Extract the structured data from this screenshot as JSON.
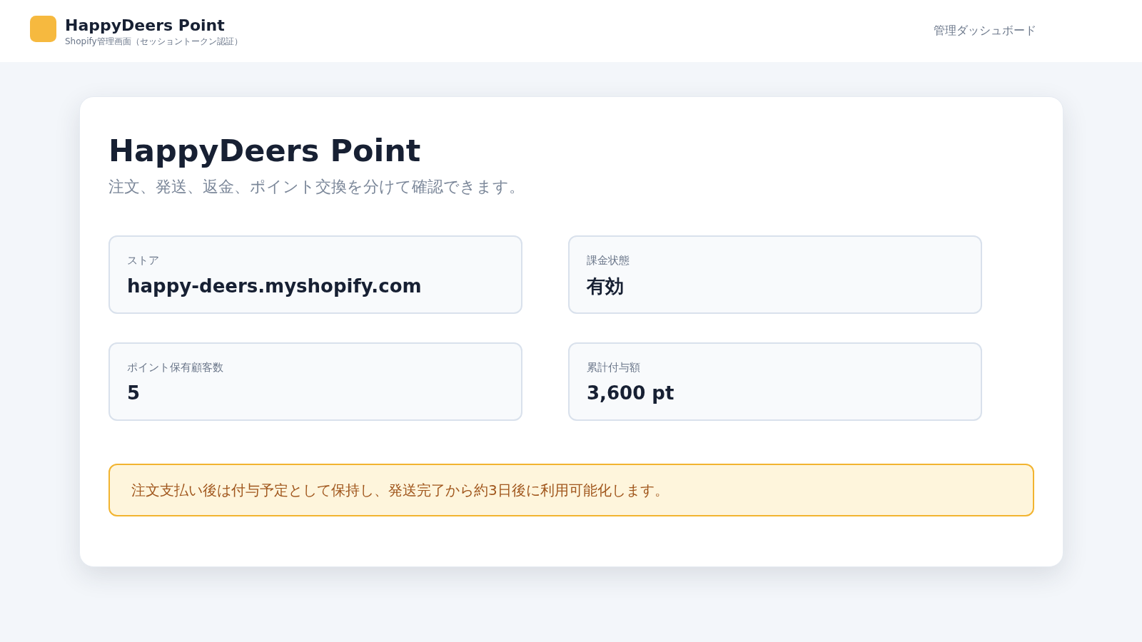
{
  "header": {
    "app_name": "HappyDeers Point",
    "subtitle": "Shopify管理画面（セッショントークン認証）",
    "nav_link": "管理ダッシュボード"
  },
  "card": {
    "title": "HappyDeers Point",
    "description": "注文、発送、返金、ポイント交換を分けて確認できます。",
    "stats": [
      {
        "label": "ストア",
        "value": "happy-deers.myshopify.com"
      },
      {
        "label": "課金状態",
        "value": "有効"
      },
      {
        "label": "ポイント保有顧客数",
        "value": "5"
      },
      {
        "label": "累計付与額",
        "value": "3,600 pt"
      }
    ],
    "notice": "注文支払い後は付与予定として保持し、発送完了から約3日後に利用可能化します。"
  }
}
